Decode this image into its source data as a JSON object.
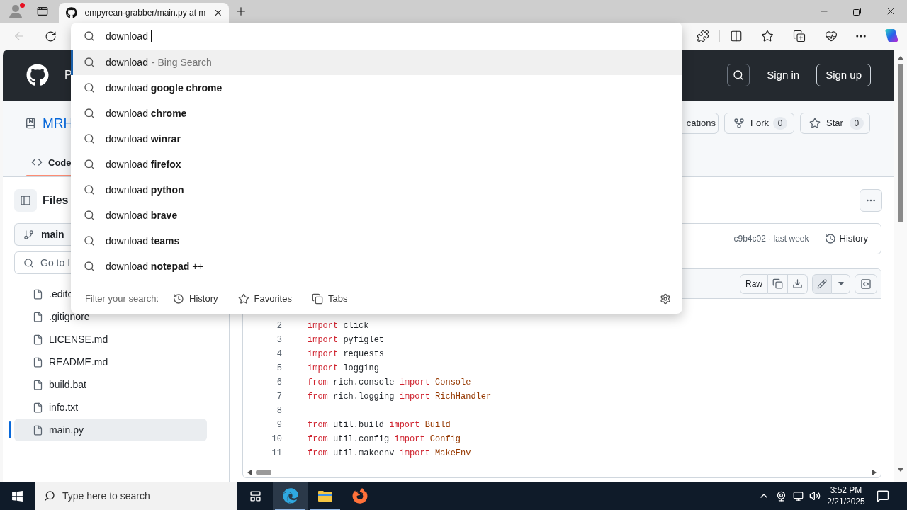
{
  "browser": {
    "tab": {
      "title": "empyrean-grabber/main.py at m"
    },
    "navigation": {
      "back_disabled": true
    },
    "address_bar": {
      "value": "download"
    },
    "suggestions": [
      {
        "text": "download",
        "hint": "- Bing Search",
        "selected": true
      },
      {
        "text": "download **google chrome**",
        "selected": false
      },
      {
        "text": "download **chrome**",
        "selected": false
      },
      {
        "text": "download **winrar**",
        "selected": false
      },
      {
        "text": "download **firefox**",
        "selected": false
      },
      {
        "text": "download **python**",
        "selected": false
      },
      {
        "text": "download **brave**",
        "selected": false
      },
      {
        "text": "download **teams**",
        "selected": false
      },
      {
        "text": "download **notepad** ++",
        "selected": false
      }
    ],
    "filter": {
      "label": "Filter your search:",
      "options": [
        {
          "kind": "history",
          "label": "History"
        },
        {
          "kind": "favorites",
          "label": "Favorites"
        },
        {
          "kind": "tabs",
          "label": "Tabs"
        }
      ]
    }
  },
  "github": {
    "header": {
      "nav": "P",
      "sign_in": "Sign in",
      "sign_up": "Sign up"
    },
    "repo": {
      "name": "MRH",
      "notifications": "cations",
      "fork": {
        "label": "Fork",
        "count": "0"
      },
      "star": {
        "label": "Star",
        "count": "0"
      }
    },
    "tabs": [
      {
        "label": "Code",
        "selected": true
      }
    ],
    "files_panel": {
      "title": "Files",
      "branch": "main",
      "search_placeholder": "Go to f",
      "files": [
        {
          "name": ".editc",
          "selected": false
        },
        {
          "name": ".gitignore",
          "selected": false
        },
        {
          "name": "LICENSE.md",
          "selected": false
        },
        {
          "name": "README.md",
          "selected": false
        },
        {
          "name": "build.bat",
          "selected": false
        },
        {
          "name": "info.txt",
          "selected": false
        },
        {
          "name": "main.py",
          "selected": true
        }
      ]
    },
    "commit": {
      "info": "c9b4c02 · last week",
      "history": "History"
    },
    "code_toolbar": {
      "raw": "Raw"
    },
    "code_lines": [
      {
        "number": "2",
        "tokens": [
          {
            "kind": "keyword",
            "text": "import"
          },
          {
            "kind": "plain",
            "text": " click"
          }
        ]
      },
      {
        "number": "3",
        "tokens": [
          {
            "kind": "keyword",
            "text": "import"
          },
          {
            "kind": "plain",
            "text": " pyfiglet"
          }
        ]
      },
      {
        "number": "4",
        "tokens": [
          {
            "kind": "keyword",
            "text": "import"
          },
          {
            "kind": "plain",
            "text": " requests"
          }
        ]
      },
      {
        "number": "5",
        "tokens": [
          {
            "kind": "keyword",
            "text": "import"
          },
          {
            "kind": "plain",
            "text": " logging"
          }
        ]
      },
      {
        "number": "6",
        "tokens": [
          {
            "kind": "keyword",
            "text": "from"
          },
          {
            "kind": "plain",
            "text": " rich.console "
          },
          {
            "kind": "keyword",
            "text": "import"
          },
          {
            "kind": "class",
            "text": " Console"
          }
        ]
      },
      {
        "number": "7",
        "tokens": [
          {
            "kind": "keyword",
            "text": "from"
          },
          {
            "kind": "plain",
            "text": " rich.logging "
          },
          {
            "kind": "keyword",
            "text": "import"
          },
          {
            "kind": "class",
            "text": " RichHandler"
          }
        ]
      },
      {
        "number": "8"
      },
      {
        "number": "9",
        "tokens": [
          {
            "kind": "keyword",
            "text": "from"
          },
          {
            "kind": "plain",
            "text": " util.build "
          },
          {
            "kind": "keyword",
            "text": "import"
          },
          {
            "kind": "class",
            "text": " Build"
          }
        ]
      },
      {
        "number": "10",
        "tokens": [
          {
            "kind": "keyword",
            "text": "from"
          },
          {
            "kind": "plain",
            "text": " util.config "
          },
          {
            "kind": "keyword",
            "text": "import"
          },
          {
            "kind": "class",
            "text": " Config"
          }
        ]
      },
      {
        "number": "11",
        "tokens": [
          {
            "kind": "keyword",
            "text": "from"
          },
          {
            "kind": "plain",
            "text": " util.makeenv "
          },
          {
            "kind": "keyword",
            "text": "import"
          },
          {
            "kind": "class",
            "text": " MakeEnv"
          }
        ]
      }
    ]
  },
  "taskbar": {
    "search_placeholder": "Type here to search",
    "apps": [
      {
        "kind": "edge",
        "active": true,
        "running": true
      },
      {
        "kind": "explorer",
        "active": false,
        "running": true
      },
      {
        "kind": "firefox",
        "active": false,
        "running": false
      }
    ],
    "time": "3:52 PM",
    "date": "2/21/2025"
  }
}
